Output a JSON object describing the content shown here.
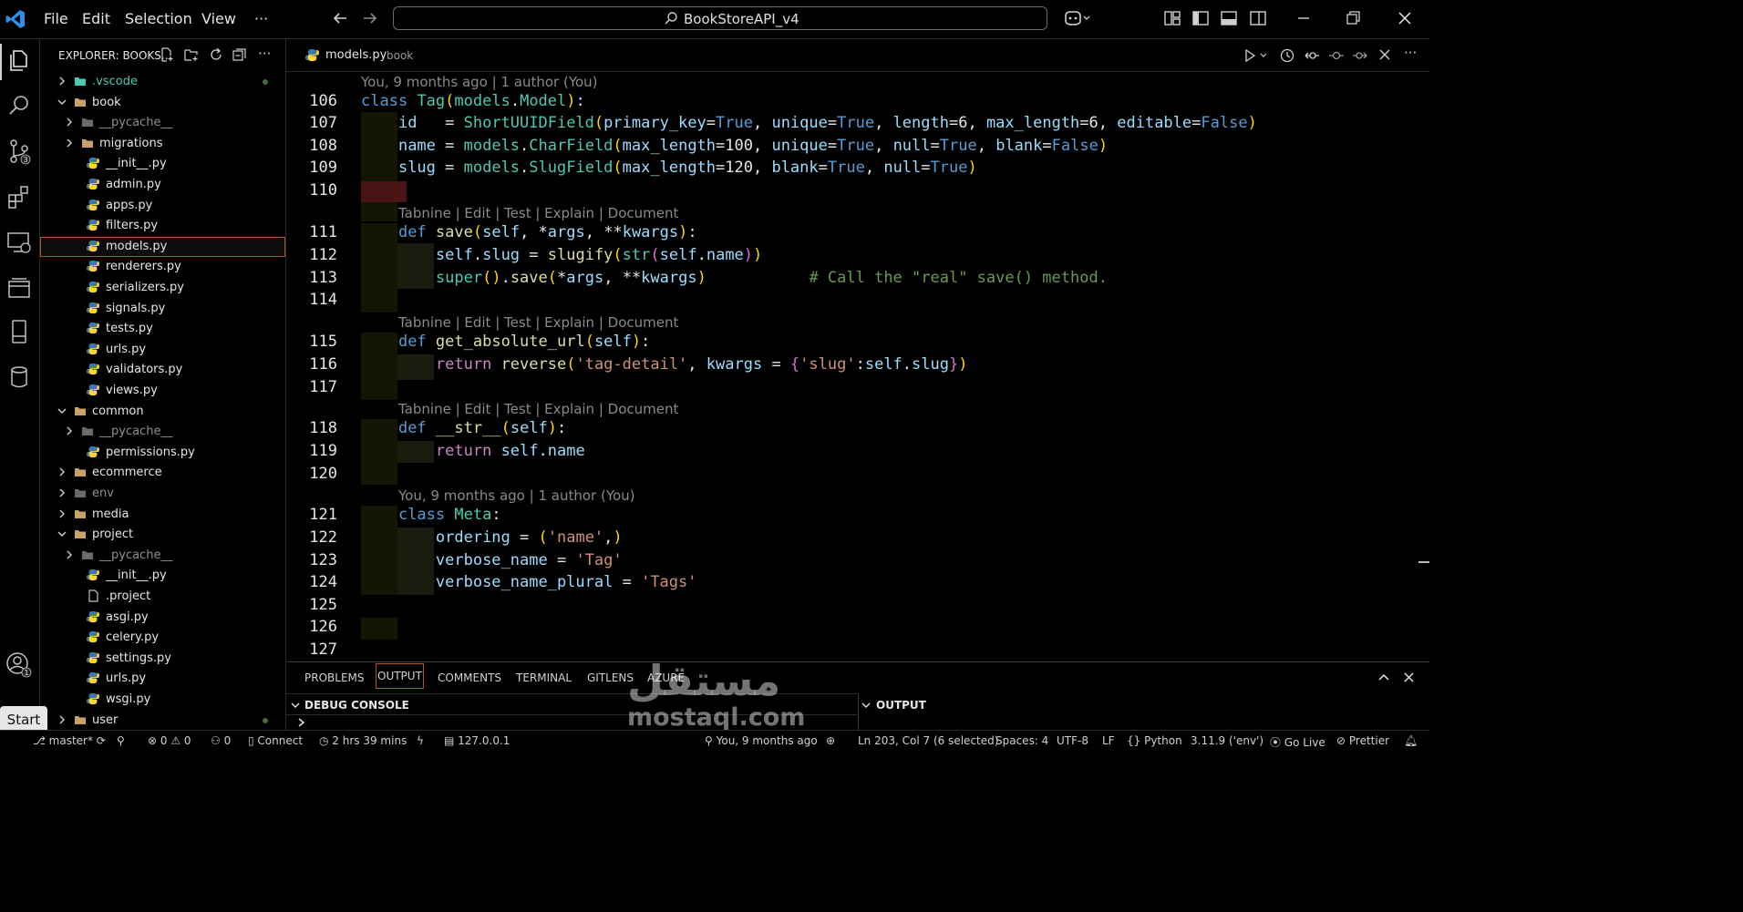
{
  "titlebar": {
    "menus": [
      "File",
      "Edit",
      "Selection",
      "View",
      "···"
    ],
    "search_text": "BookStoreAPI_v4"
  },
  "explorer": {
    "title": "EXPLORER: BOOKS...",
    "items": [
      {
        "label": ".vscode",
        "type": "folder",
        "color": "#4ec9b0"
      },
      {
        "label": "book",
        "type": "folder-open"
      },
      {
        "label": "__pycache__",
        "type": "folder",
        "dim": true
      },
      {
        "label": "migrations",
        "type": "folder"
      },
      {
        "label": "__init__.py",
        "type": "py"
      },
      {
        "label": "admin.py",
        "type": "py"
      },
      {
        "label": "apps.py",
        "type": "py"
      },
      {
        "label": "filters.py",
        "type": "py"
      },
      {
        "label": "models.py",
        "type": "py",
        "selected": true
      },
      {
        "label": "renderers.py",
        "type": "py"
      },
      {
        "label": "serializers.py",
        "type": "py"
      },
      {
        "label": "signals.py",
        "type": "py"
      },
      {
        "label": "tests.py",
        "type": "py"
      },
      {
        "label": "urls.py",
        "type": "py"
      },
      {
        "label": "validators.py",
        "type": "py"
      },
      {
        "label": "views.py",
        "type": "py"
      },
      {
        "label": "common",
        "type": "folder-open"
      },
      {
        "label": "__pycache__",
        "type": "folder",
        "dim": true
      },
      {
        "label": "permissions.py",
        "type": "py"
      },
      {
        "label": "ecommerce",
        "type": "folder"
      },
      {
        "label": "env",
        "type": "folder",
        "dim": true
      },
      {
        "label": "media",
        "type": "folder"
      },
      {
        "label": "project",
        "type": "folder-open"
      },
      {
        "label": "__pycache__",
        "type": "folder",
        "dim": true
      },
      {
        "label": "__init__.py",
        "type": "py"
      },
      {
        "label": ".project",
        "type": "file"
      },
      {
        "label": "asgi.py",
        "type": "py"
      },
      {
        "label": "celery.py",
        "type": "py"
      },
      {
        "label": "settings.py",
        "type": "py"
      },
      {
        "label": "urls.py",
        "type": "py"
      },
      {
        "label": "wsgi.py",
        "type": "py"
      },
      {
        "label": "user",
        "type": "folder"
      }
    ]
  },
  "tab": {
    "filename": "models.py",
    "folder": "book"
  },
  "codelens": "Tabnine | Edit | Test | Explain | Document",
  "blame_top": "You, 9 months ago | 1 author (You)",
  "blame_meta": "You, 9 months ago | 1 author (You)",
  "line_numbers": [
    "106",
    "107",
    "108",
    "109",
    "110",
    "111",
    "112",
    "113",
    "114",
    "115",
    "116",
    "117",
    "118",
    "119",
    "120",
    "121",
    "122",
    "123",
    "124",
    "125",
    "126",
    "127"
  ],
  "panel": {
    "tabs": [
      "PROBLEMS",
      "OUTPUT",
      "COMMENTS",
      "TERMINAL",
      "GITLENS",
      "AZURE"
    ],
    "debug_console": "DEBUG CONSOLE",
    "output": "OUTPUT"
  },
  "start_button": "Start",
  "watermark": {
    "arabic": "مستقل",
    "latin": "mostaql.com"
  },
  "status": {
    "branch": "master*",
    "errors": "0",
    "warnings": "0",
    "ports": "0",
    "connect": "Connect",
    "timer": "2 hrs 39 mins",
    "host": "127.0.0.1",
    "blame": "You, 9 months ago",
    "position": "Ln 203, Col 7 (6 selected)",
    "spaces": "Spaces: 4",
    "encoding": "UTF-8",
    "eol": "LF",
    "language": "Python",
    "interpreter": "3.11.9 ('env')",
    "golive": "Go Live",
    "prettier": "Prettier"
  },
  "accent_color": "#b0522a",
  "python_badge_colors": [
    "#3c78aa",
    "#ffd43b"
  ]
}
